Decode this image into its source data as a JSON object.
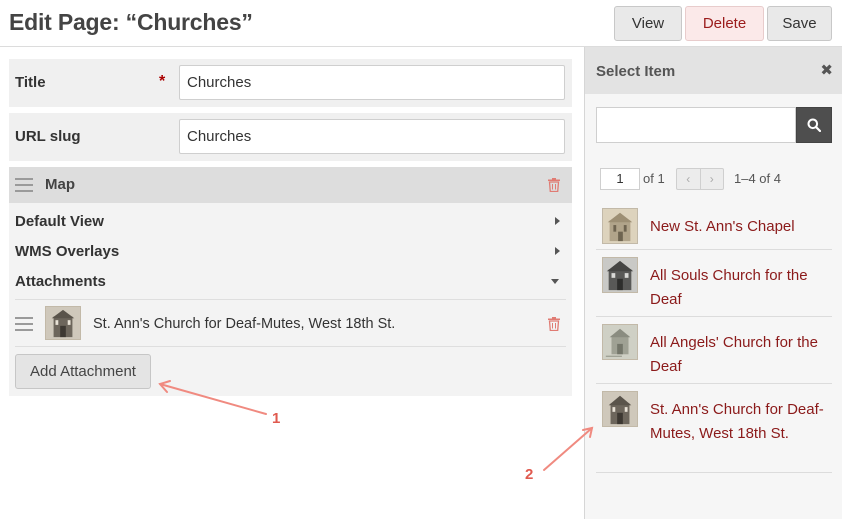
{
  "header": {
    "title": "Edit Page: “Churches”",
    "view_label": "View",
    "delete_label": "Delete",
    "save_label": "Save"
  },
  "form": {
    "title_label": "Title",
    "required_mark": "*",
    "title_value": "Churches",
    "slug_label": "URL slug",
    "slug_value": "Churches"
  },
  "map": {
    "heading": "Map",
    "sections": [
      "Default View",
      "WMS Overlays",
      "Attachments"
    ],
    "attachment": "St. Ann's Church for Deaf-Mutes, West 18th St.",
    "add_label": "Add Attachment"
  },
  "panel": {
    "title": "Select Item",
    "close": "✖",
    "search_value": "",
    "page_value": "1",
    "of_text": "of 1",
    "prev": "‹",
    "next": "›",
    "range_text": "1–4 of 4",
    "items": [
      {
        "label": "New St. Ann's Chapel",
        "icon": "sketch-thumbnail"
      },
      {
        "label": "All Souls Church for the Deaf",
        "icon": "photo-thumbnail"
      },
      {
        "label": "All Angels' Church for the Deaf",
        "icon": "postcard-thumbnail"
      },
      {
        "label": "St. Ann's Church for Deaf-Mutes, West 18th St.",
        "icon": "photo-thumbnail"
      }
    ]
  },
  "annotations": {
    "marker_1": "1",
    "marker_2": "2",
    "arrow_color": "#f08a80"
  },
  "colors": {
    "link": "#8b1a1a",
    "delete_text": "#9b1c1c",
    "required": "#aa0000"
  }
}
